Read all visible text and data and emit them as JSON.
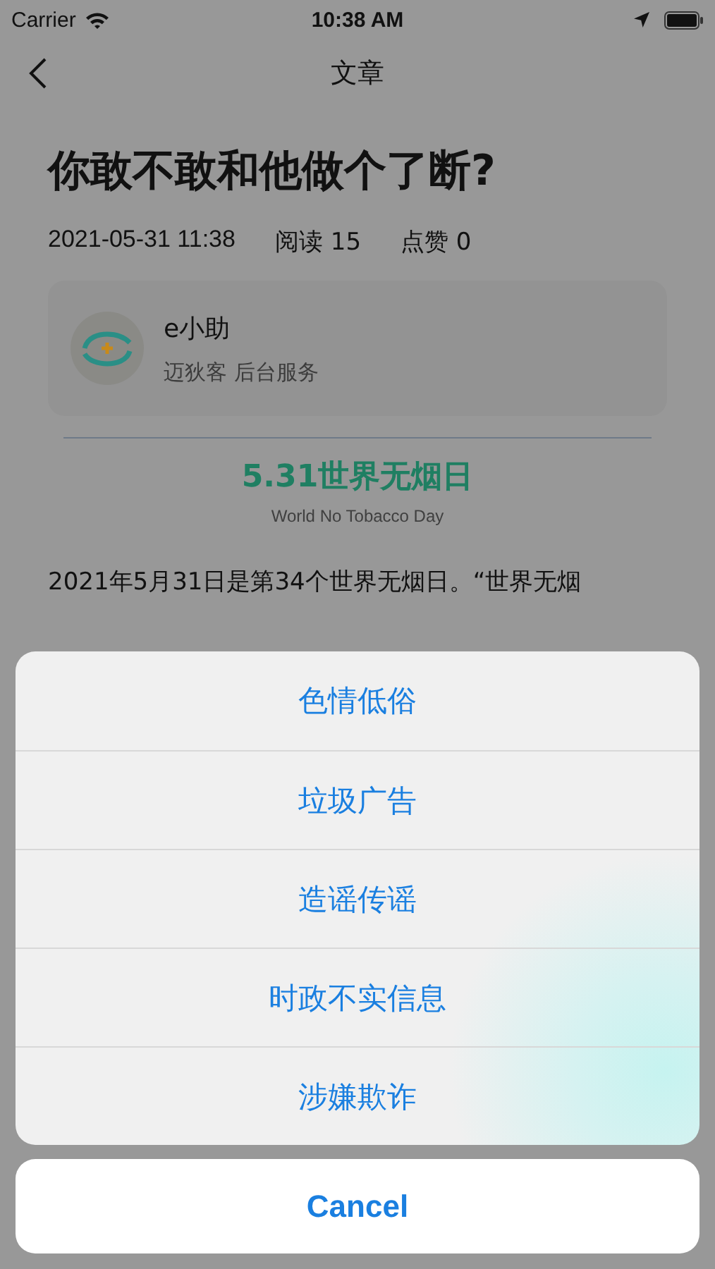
{
  "status_bar": {
    "carrier": "Carrier",
    "time": "10:38 AM"
  },
  "nav": {
    "title": "文章"
  },
  "article": {
    "title": "你敢不敢和他做个了断?",
    "date": "2021-05-31 11:38",
    "reads": "阅读 15",
    "likes": "点赞 0",
    "author": {
      "name": "e小助",
      "org": "迈狄客 后台服务"
    },
    "banner": {
      "title": "5.31世界无烟日",
      "subtitle": "World No Tobacco Day"
    },
    "paragraph": "2021年5月31日是第34个世界无烟日。“世界无烟"
  },
  "action_sheet": {
    "options": [
      "色情低俗",
      "垃圾广告",
      "造谣传谣",
      "时政不实信息",
      "涉嫌欺诈"
    ],
    "cancel": "Cancel"
  }
}
